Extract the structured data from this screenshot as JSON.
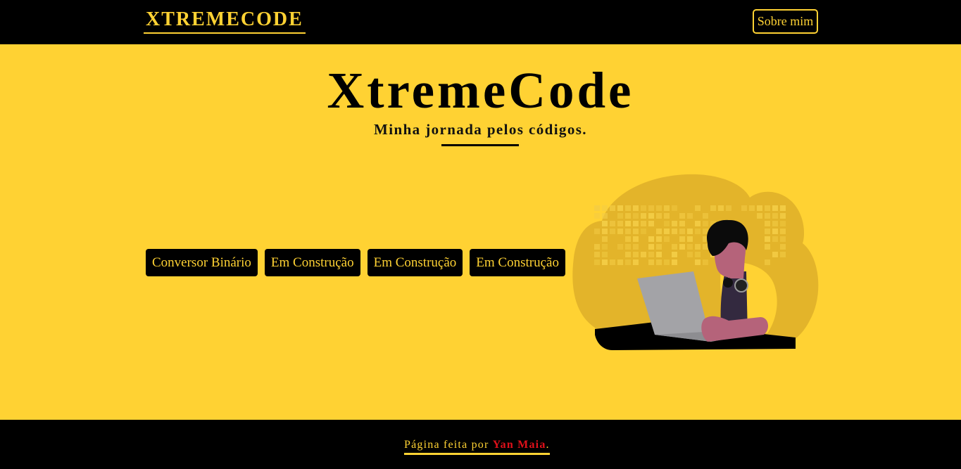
{
  "header": {
    "logo": "XTREMECODE",
    "about_label": "Sobre mim"
  },
  "hero": {
    "title": "XtremeCode",
    "subtitle": "Minha jornada pelos códigos."
  },
  "projects": [
    {
      "label": "Conversor Binário"
    },
    {
      "label": "Em Construção"
    },
    {
      "label": "Em Construção"
    },
    {
      "label": "Em Construção"
    }
  ],
  "illustration": {
    "icon": "person-with-laptop-illustration"
  },
  "footer": {
    "prefix": "Página feita por ",
    "author": "Yan Maia",
    "suffix": "."
  },
  "colors": {
    "accent": "#ffd233",
    "dark": "#000000",
    "author": "#e0101a"
  }
}
